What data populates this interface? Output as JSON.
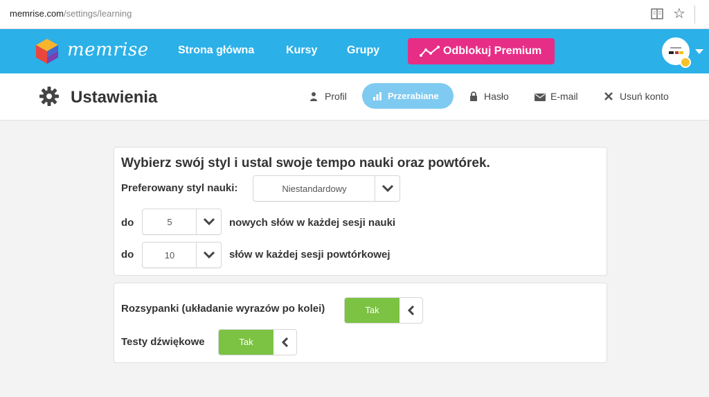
{
  "browser": {
    "url_domain": "memrise.com",
    "url_path": "/settings/learning",
    "reader_icon": "reader-view-icon",
    "bookmark_icon": "star-icon"
  },
  "nav": {
    "logo_text": "memrise",
    "home": "Strona główna",
    "courses": "Kursy",
    "groups": "Grupy",
    "premium": "Odblokuj Premium",
    "colors": {
      "bar": "#2bb0e8",
      "premium": "#e72e86"
    }
  },
  "settings": {
    "title": "Ustawienia",
    "tabs": {
      "profile": "Profil",
      "learning": "Przerabiane",
      "password": "Hasło",
      "email": "E-mail",
      "delete": "Usuń konto"
    }
  },
  "learning": {
    "heading": "Wybierz swój styl i ustal swoje tempo nauki oraz powtórek.",
    "style_label": "Preferowany styl nauki:",
    "style_value": "Niestandardowy",
    "new_prefix": "do",
    "new_value": "5",
    "new_suffix": "nowych słów w każdej sesji nauki",
    "review_prefix": "do",
    "review_value": "10",
    "review_suffix": "słów w każdej sesji powtórkowej"
  },
  "toggles": {
    "scramble_label": "Rozsypanki (układanie wyrazów po kolei)",
    "scramble_value": "Tak",
    "audio_label": "Testy dźwiękowe",
    "audio_value": "Tak",
    "on_color": "#7cc243"
  }
}
